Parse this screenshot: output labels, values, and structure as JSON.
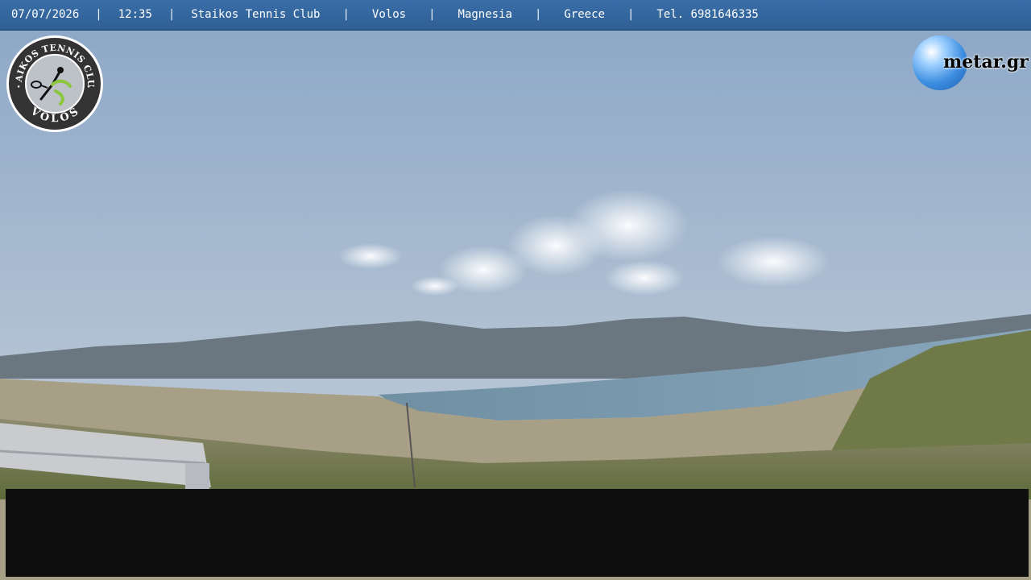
{
  "header": {
    "date": "07/07/2026",
    "time": "12:35",
    "club": "Staikos Tennis Club",
    "city": "Volos",
    "region": "Magnesia",
    "country": "Greece",
    "phone": "Tel. 6981646335",
    "separator": "|"
  },
  "logo_left": {
    "top_text": "STAIKOS TENNIS CLUB",
    "bottom_text": "VOLOS"
  },
  "logo_right": {
    "brand": "metar.gr"
  },
  "colors": {
    "header_bg": "#3a6ea8",
    "overlay_black": "#0e0e0e"
  }
}
